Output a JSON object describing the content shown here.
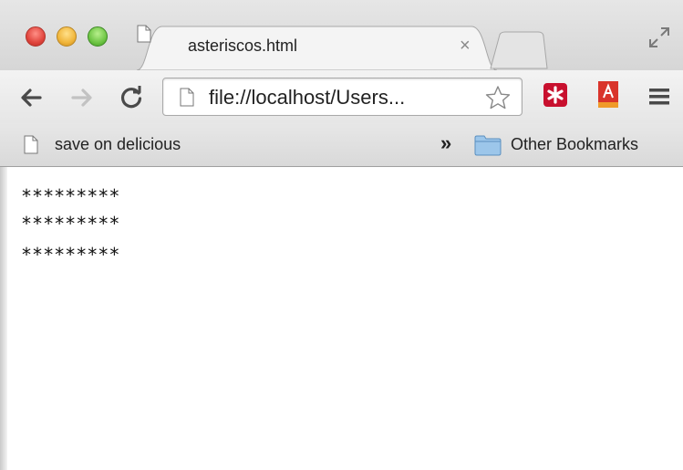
{
  "window": {
    "tab_title": "asteriscos.html",
    "tab_close": "×"
  },
  "toolbar": {
    "url": "file://localhost/Users..."
  },
  "bookmarks": {
    "item_label": "save on delicious",
    "overflow": "»",
    "other_label": "Other Bookmarks"
  },
  "content": {
    "lines": [
      "*********",
      "*********",
      "*********"
    ]
  },
  "colors": {
    "close": "#e0443c",
    "minimize": "#f0b53a",
    "zoom": "#6ec544",
    "lastpass": "#c8102e",
    "pdf": "#d9342b",
    "folder": "#6fa6d6"
  },
  "icons": [
    "back-arrow-icon",
    "forward-arrow-icon",
    "reload-icon",
    "page-icon",
    "star-icon",
    "lastpass-icon",
    "pdf-icon",
    "menu-icon",
    "folder-icon",
    "fullscreen-icon"
  ]
}
